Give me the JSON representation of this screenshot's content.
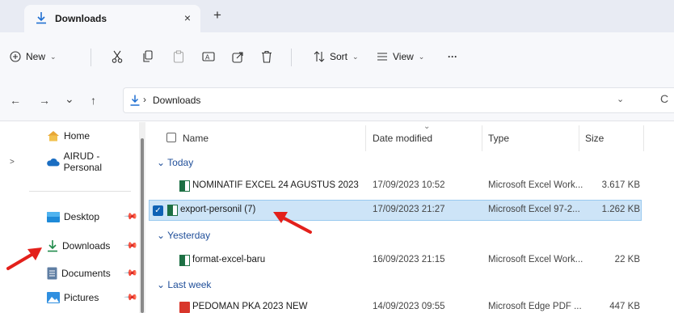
{
  "tab": {
    "title": "Downloads",
    "close": "×",
    "new_tab": "+"
  },
  "toolbar": {
    "new_label": "New",
    "sort_label": "Sort",
    "view_label": "View",
    "more_label": "···",
    "icons": [
      "cut-icon",
      "copy-icon",
      "paste-icon",
      "rename-icon",
      "share-icon",
      "delete-icon"
    ]
  },
  "address": {
    "back": "←",
    "forward": "→",
    "recent": "⌄",
    "up": "↑",
    "separator": "›",
    "crumb": "Downloads",
    "chevron": "⌄",
    "refresh": "C"
  },
  "sidebar": {
    "items": [
      {
        "label": "Home",
        "icon": "home-icon",
        "pinned": false
      },
      {
        "label": "AIRUD - Personal",
        "icon": "cloud-icon",
        "pinned": false,
        "expander": ">"
      },
      {
        "label": "Desktop",
        "icon": "desktop-icon",
        "pinned": true
      },
      {
        "label": "Downloads",
        "icon": "download-icon",
        "pinned": true
      },
      {
        "label": "Documents",
        "icon": "document-icon",
        "pinned": true
      },
      {
        "label": "Pictures",
        "icon": "pictures-icon",
        "pinned": true
      }
    ]
  },
  "columns": {
    "name": "Name",
    "date": "Date modified",
    "type": "Type",
    "size": "Size",
    "sort_indicator": "⌄"
  },
  "groups": {
    "today": "Today",
    "yesterday": "Yesterday",
    "last_week": "Last week"
  },
  "files": [
    {
      "name": "NOMINATIF EXCEL 24 AGUSTUS 2023",
      "date": "17/09/2023 10:52",
      "type": "Microsoft Excel Work...",
      "size": "3.617 KB",
      "icon": "excel-file-icon",
      "selected": false
    },
    {
      "name": "export-personil (7)",
      "date": "17/09/2023 21:27",
      "type": "Microsoft Excel 97-2...",
      "size": "1.262 KB",
      "icon": "excel-file-icon",
      "selected": true
    },
    {
      "name": "format-excel-baru",
      "date": "16/09/2023 21:15",
      "type": "Microsoft Excel Work...",
      "size": "22 KB",
      "icon": "excel-file-icon",
      "selected": false
    },
    {
      "name": "PEDOMAN PKA 2023 NEW",
      "date": "14/09/2023 09:55",
      "type": "Microsoft Edge PDF ...",
      "size": "447 KB",
      "icon": "pdf-file-icon",
      "selected": false
    }
  ],
  "colors": {
    "selection": "#cde4f7",
    "accent": "#0f62b5",
    "annotation": "#e3201b"
  }
}
